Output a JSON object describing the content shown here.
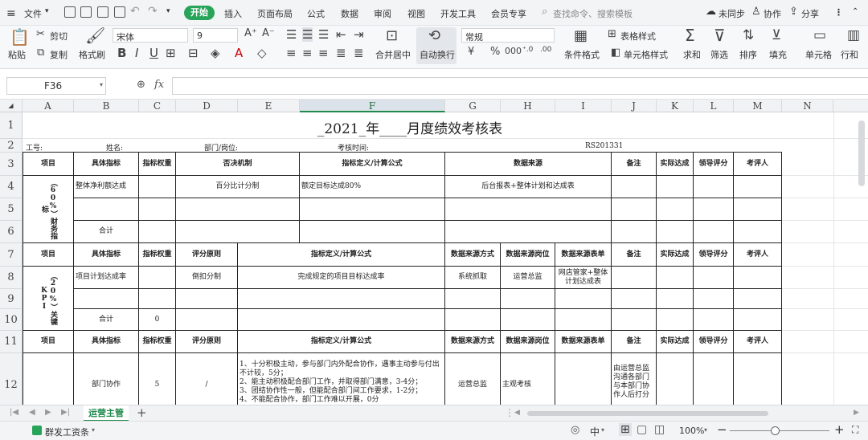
{
  "menu": {
    "file": "文件",
    "tabs": [
      "开始",
      "插入",
      "页面布局",
      "公式",
      "数据",
      "审阅",
      "视图",
      "开发工具",
      "会员专享"
    ],
    "search_placeholder": "查找命令、搜索模板",
    "sync": "未同步",
    "collab": "协作",
    "share": "分享"
  },
  "ribbon": {
    "paste": "粘贴",
    "cut": "剪切",
    "copy": "复制",
    "format_painter": "格式刷",
    "font_name": "宋体",
    "font_size": "9",
    "merge_center": "合并居中",
    "auto_wrap": "自动换行",
    "number_format": "常规",
    "table_style": "表格样式",
    "cond_format": "条件格式",
    "cell_style": "单元格样式",
    "sum": "求和",
    "filter": "筛选",
    "sort": "排序",
    "fill": "填充",
    "cell": "单元格",
    "row_col": "行和"
  },
  "formula_bar": {
    "name_box": "F36",
    "fx": "fx"
  },
  "columns": [
    "A",
    "B",
    "C",
    "D",
    "E",
    "F",
    "G",
    "H",
    "I",
    "J",
    "K",
    "L",
    "M",
    "N"
  ],
  "rows": [
    "1",
    "2",
    "3",
    "4",
    "5",
    "6",
    "7",
    "8",
    "9",
    "10",
    "11",
    "12"
  ],
  "sheet": {
    "title": "_2021_年____月度绩效考核表",
    "r2": {
      "gonghao": "工号:",
      "name": "姓名:",
      "dept": "部门/岗位:",
      "time": "考核时间:",
      "code": "RS201331"
    },
    "sec1_header": [
      "项目",
      "具体指标",
      "指标权重",
      "否决机制",
      "指标定义/计算公式",
      "数据来源",
      "备注",
      "实际达成",
      "领导评分",
      "考评人"
    ],
    "sec1_item": "（60%）财务指标",
    "r4": {
      "metric": "整体净利额达成",
      "rule": "百分比计分制",
      "def": "额定目标达成80%",
      "source": "后台报表+整体计划和达成表"
    },
    "sec1_total": "合计",
    "sec2_header": [
      "项目",
      "具体指标",
      "指标权重",
      "评分原则",
      "指标定义/计算公式",
      "数据来源方式",
      "数据来源岗位",
      "数据来源表单",
      "备注",
      "实际达成",
      "领导评分",
      "考评人"
    ],
    "sec2_item": "（20%）关键KPI",
    "r8": {
      "metric": "项目计划达成率",
      "rule": "倒扣分制",
      "def": "完成规定的项目目标达成率",
      "method": "系统抓取",
      "post": "运营总监",
      "form": "网店管家+整体计划达成表"
    },
    "sec2_total": "合计",
    "sec2_total_weight": "0",
    "r12": {
      "metric": "部门协作",
      "weight": "5",
      "rule": "/",
      "def": [
        "1、十分积极主动，参与部门内外配合协作，遇事主动参与付出不计较，5分；",
        "2、能主动积极配合部门工作，并取得部门满意，3-4分；",
        "3、团结协作性一般，但能配合部门间工作要求，1-2分；",
        "4、不能配合协作，部门工作难以开展，0分"
      ],
      "method": "运营总监",
      "post": "主观考核",
      "remark": "由运营总监沟通各部门与本部门协作人后打分"
    }
  },
  "sheet_tab": "运营主管",
  "status": {
    "workbook": "群发工资条",
    "input_mode": "中",
    "zoom": "100%"
  }
}
